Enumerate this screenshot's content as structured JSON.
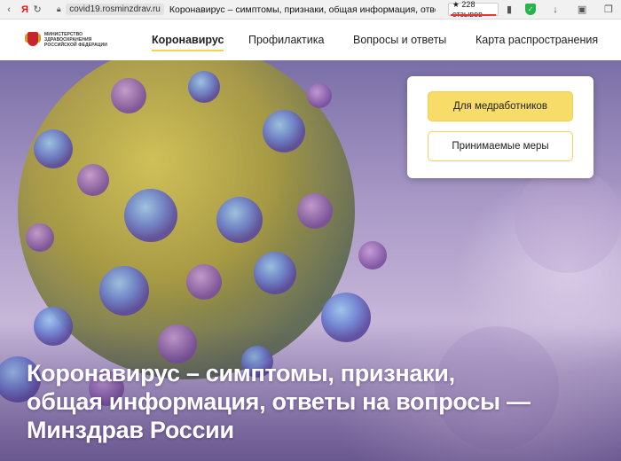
{
  "browser": {
    "domain": "covid19.rosminzdrav.ru",
    "title": "Коронавирус – симптомы, признаки, общая информация, ответы...",
    "reviews": "★ 228 отзывов",
    "yandex_glyph": "Я"
  },
  "site": {
    "logo_lines": [
      "МИНИСТЕРСТВО",
      "ЗДРАВООХРАНЕНИЯ",
      "РОССИЙСКОЙ ФЕДЕРАЦИИ"
    ],
    "nav": [
      {
        "label": "Коронавирус",
        "active": true
      },
      {
        "label": "Профилактика",
        "active": false
      },
      {
        "label": "Вопросы и ответы",
        "active": false
      },
      {
        "label": "Карта распространения",
        "active": false
      }
    ],
    "card": {
      "primary_label": "Для медработников",
      "secondary_label": "Принимаемые меры"
    },
    "hero_title_lines": [
      "Коронавирус – симптомы, признаки,",
      "общая информация, ответы на вопросы —",
      "Минздрав России"
    ]
  },
  "colors": {
    "accent_yellow": "#f7dc6a",
    "emblem_red": "#c8242b",
    "shield_green": "#29b34b"
  }
}
